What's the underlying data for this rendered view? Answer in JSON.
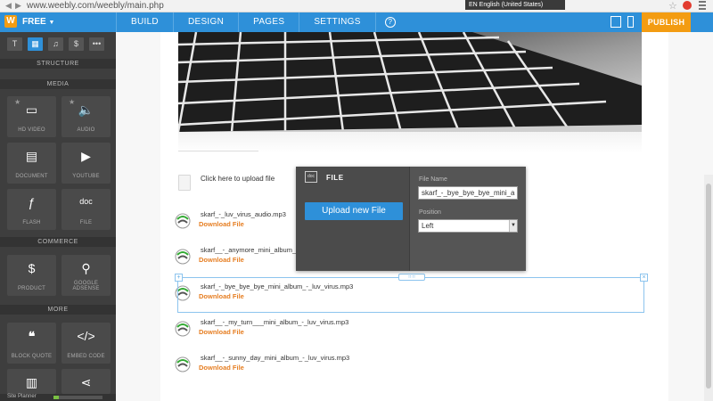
{
  "browser": {
    "address": "www.weebly.com/weebly/main.php",
    "language": "EN English (United States)"
  },
  "topbar": {
    "plan": "FREE",
    "tabs": [
      "BUILD",
      "DESIGN",
      "PAGES",
      "SETTINGS"
    ],
    "help": "?",
    "publish": "PUBLISH"
  },
  "sidebar": {
    "sections": {
      "structure": "STRUCTURE",
      "media": "MEDIA",
      "commerce": "COMMERCE",
      "more": "MORE"
    },
    "media_tiles": [
      "HD VIDEO",
      "AUDIO",
      "DOCUMENT",
      "YOUTUBE",
      "FLASH",
      "FILE"
    ],
    "commerce_tiles": [
      "PRODUCT",
      "GOOGLE ADSENSE"
    ],
    "more_tiles": [
      "BLOCK QUOTE",
      "EMBED CODE"
    ],
    "planner": "Site Planner",
    "planner_progress": 0.1
  },
  "content": {
    "upload_prompt": "Click here to upload file",
    "files": [
      {
        "name": "skarf_-_luv_virus_audio.mp3",
        "link": "Download File"
      },
      {
        "name": "skarf__-_anymore_mini_album_",
        "link": "Download File"
      },
      {
        "name": "skarf_-_bye_bye_bye_mini_album_-_luv_virus.mp3",
        "link": "Download File"
      },
      {
        "name": "skarf__-_my_turn___mini_album_-_luv_virus.mp3",
        "link": "Download File"
      },
      {
        "name": "skarf__-_sunny_day_mini_album_-_luv_virus.mp3",
        "link": "Download File"
      }
    ]
  },
  "file_panel": {
    "icon": "doc",
    "title": "FILE",
    "upload_button": "Upload new File",
    "file_name_label": "File Name",
    "file_name_value": "skarf_-_bye_bye_bye_mini_a",
    "position_label": "Position",
    "position_value": "Left"
  },
  "colors": {
    "accent": "#2e90d9",
    "publish": "#f39c12",
    "download_link": "#e67e22"
  }
}
